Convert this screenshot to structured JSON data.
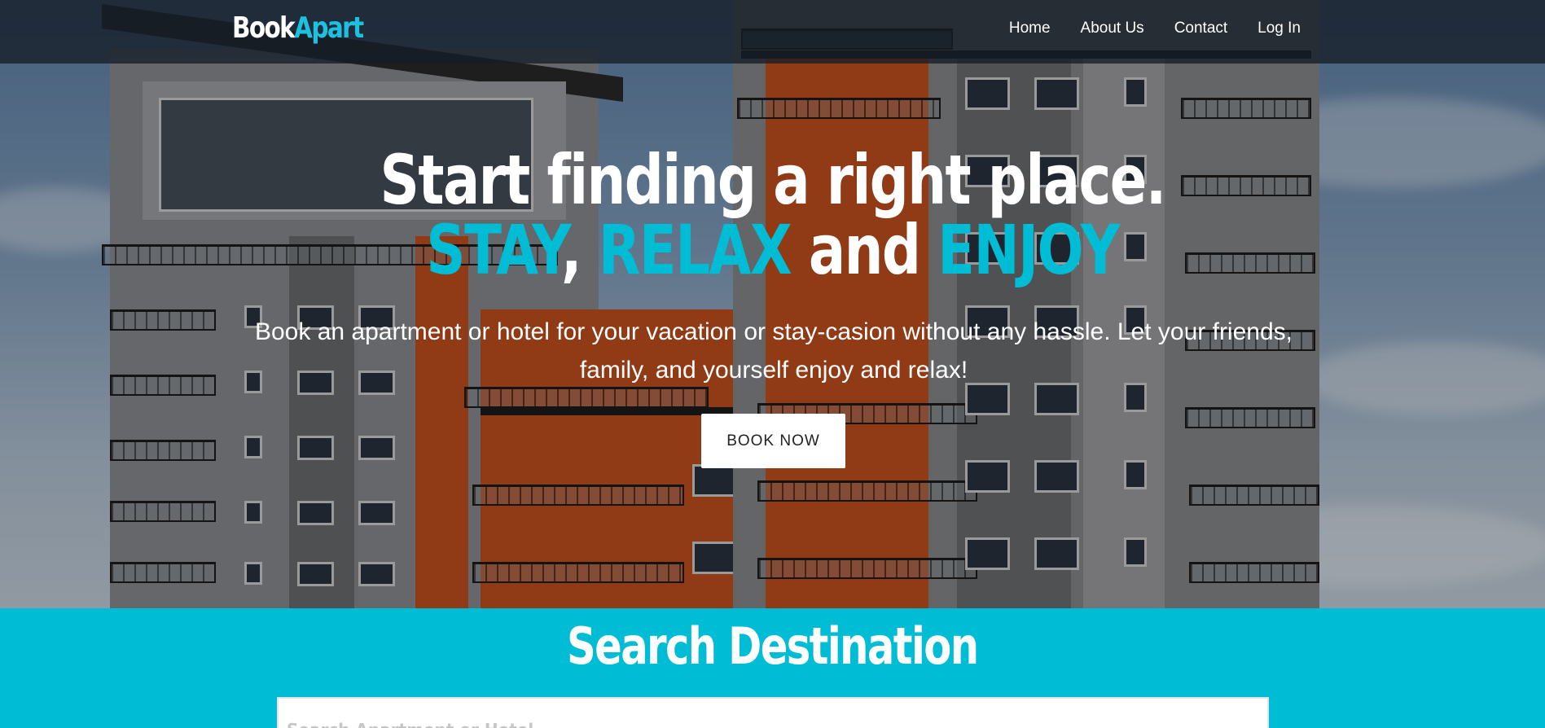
{
  "brand": {
    "part1": "Book",
    "part2": "Apart"
  },
  "nav": {
    "items": [
      {
        "label": "Home"
      },
      {
        "label": "About Us"
      },
      {
        "label": "Contact"
      },
      {
        "label": "Log In"
      }
    ]
  },
  "hero": {
    "headline_line1": "Start finding a right place.",
    "headline_line2": {
      "word1": "STAY",
      "sep1": ", ",
      "word2": "RELAX",
      "sep2": " and ",
      "word3": "ENJOY"
    },
    "tagline": "Book an apartment or hotel for your vacation or stay-casion without any hassle. Let your friends, family, and yourself enjoy and relax!",
    "cta_label": "BOOK NOW"
  },
  "search": {
    "title": "Search Destination",
    "placeholder": "Search Apartment or Hotel",
    "value": ""
  },
  "colors": {
    "accent": "#00bcd4",
    "nav_bg": "#161e28",
    "text_light": "#ffffff"
  }
}
